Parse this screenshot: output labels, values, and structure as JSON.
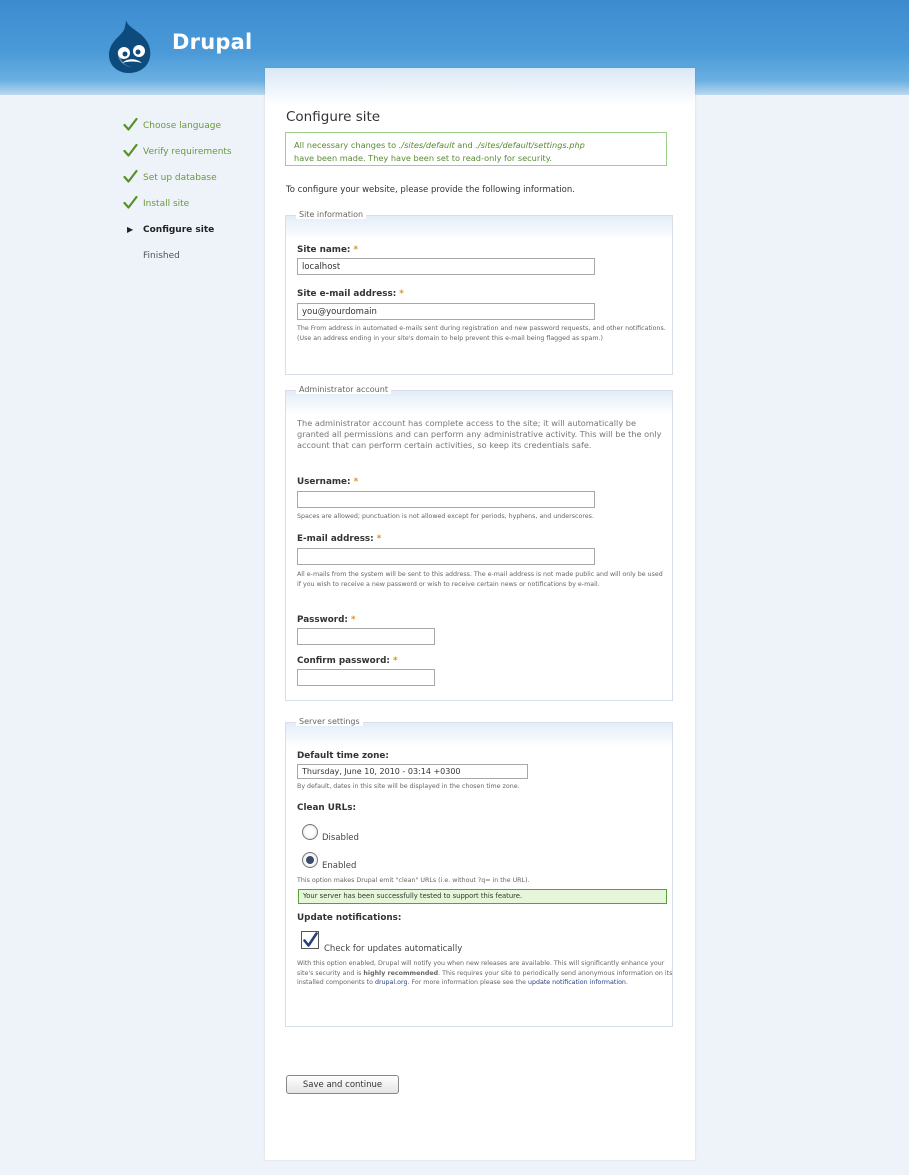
{
  "site_name": "Drupal",
  "tasks": [
    {
      "label": "Choose language",
      "state": "done"
    },
    {
      "label": "Verify requirements",
      "state": "done"
    },
    {
      "label": "Set up database",
      "state": "done"
    },
    {
      "label": "Install site",
      "state": "done"
    },
    {
      "label": "Configure site",
      "state": "active"
    },
    {
      "label": "Finished",
      "state": "pending"
    }
  ],
  "main": {
    "title": "Configure site",
    "status_message": {
      "prefix": "All necessary changes to ",
      "path1": "./sites/default",
      "mid": " and ",
      "path2": "./sites/default/settings.php",
      "suffix": "have been made. They have been set to read-only for security."
    },
    "intro": "To configure your website, please provide the following information."
  },
  "site_info": {
    "legend": "Site information",
    "site_name_label": "Site name: ",
    "site_name_value": "localhost",
    "site_mail_label": "Site e-mail address: ",
    "site_mail_value": "you@yourdomain",
    "site_mail_desc": "The From address in automated e-mails sent during registration and new password requests, and other notifications. (Use an address ending in your site's domain to help prevent this e-mail being flagged as spam.)"
  },
  "admin": {
    "legend": "Administrator account",
    "intro": "The administrator account has complete access to the site; it will automatically be granted all permissions and can perform any administrative activity. This will be the only account that can perform certain activities, so keep its credentials safe.",
    "username_label": "Username: ",
    "username_desc": "Spaces are allowed; punctuation is not allowed except for periods, hyphens, and underscores.",
    "email_label": "E-mail address: ",
    "email_desc": "All e-mails from the system will be sent to this address. The e-mail address is not made public and will only be used if you wish to receive a new password or wish to receive certain news or notifications by e-mail.",
    "password_label": "Password: ",
    "confirm_label": "Confirm password: "
  },
  "server": {
    "legend": "Server settings",
    "tz_label": "Default time zone:",
    "tz_value": "Thursday, June 10, 2010 - 03:14 +0300",
    "tz_desc": "By default, dates in this site will be displayed in the chosen time zone.",
    "clean_label": "Clean URLs:",
    "disabled_label": "Disabled",
    "enabled_label": "Enabled",
    "clean_desc": "This option makes Drupal emit \"clean\" URLs (i.e. without ?q= in the URL).",
    "clean_ok": "Your server has been successfully tested to support this feature.",
    "update_label": "Update notifications:",
    "check_label": "Check for updates automatically",
    "update_desc_1": "With this option enabled, Drupal will notify you when new releases are available. This will significantly enhance your site's security and is ",
    "update_desc_bold": "highly recommended",
    "update_desc_2": ". This requires your site to periodically send anonymous information on its installed components to ",
    "update_desc_link1": "drupal.org",
    "update_desc_3": ". For more information please see the ",
    "update_desc_link2": "update notification information",
    "update_desc_4": "."
  },
  "save_label": "Save and continue",
  "colors": {
    "header": "#4a9ad8",
    "done": "#6a9a36",
    "required": "#e09010"
  },
  "icons": {
    "logo": "drupal-drop-icon",
    "done": "check-icon",
    "active": "arrow-right-icon"
  }
}
